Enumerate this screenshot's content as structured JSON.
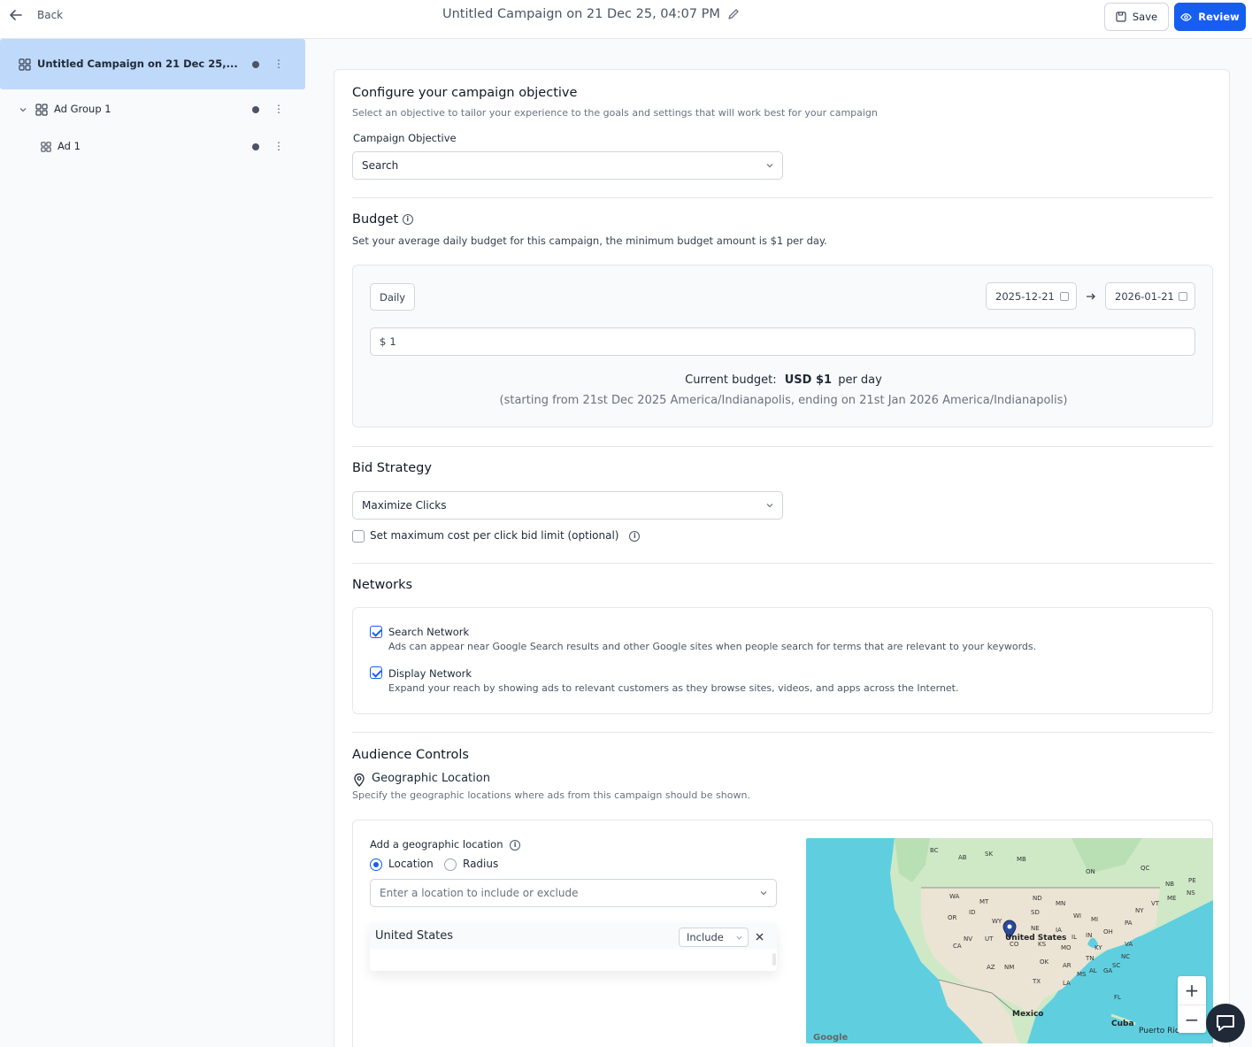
{
  "header": {
    "back_label": "Back",
    "title": "Untitled Campaign on 21 Dec 25, 04:07 PM",
    "save_label": "Save",
    "review_label": "Review"
  },
  "sidebar": {
    "items": [
      {
        "label": "Untitled Campaign on 21 Dec 25,..."
      },
      {
        "label": "Ad Group 1"
      },
      {
        "label": "Ad 1"
      }
    ]
  },
  "objective": {
    "heading": "Configure your campaign objective",
    "description": "Select an objective to tailor your experience to the goals and settings that will work best for your campaign",
    "field_label": "Campaign Objective",
    "value": "Search"
  },
  "budget": {
    "heading": "Budget",
    "description": "Set your average daily budget for this campaign, the minimum budget amount is $1 per day.",
    "type_label": "Daily",
    "start_date": "2025-12-21",
    "end_date": "2026-01-21",
    "amount_prefix": "$",
    "amount": "1",
    "current_prefix": "Current budget:",
    "current_value": "USD $1",
    "current_suffix": "per day",
    "range_text": "(starting from 21st Dec 2025 America/Indianapolis, ending on 21st Jan 2026 America/Indianapolis)"
  },
  "bid": {
    "heading": "Bid Strategy",
    "value": "Maximize Clicks",
    "limit_label": "Set maximum cost per click bid limit (optional)"
  },
  "networks": {
    "heading": "Networks",
    "items": [
      {
        "name": "Search Network",
        "desc": "Ads can appear near Google Search results and other Google sites when people search for terms that are relevant to your keywords."
      },
      {
        "name": "Display Network",
        "desc": "Expand your reach by showing ads to relevant customers as they browse sites, videos, and apps across the Internet."
      }
    ]
  },
  "audience": {
    "heading": "Audience Controls",
    "geo_title": "Geographic Location",
    "geo_desc": "Specify the geographic locations where ads from this campaign should be shown.",
    "add_label": "Add a geographic location",
    "radio_location": "Location",
    "radio_radius": "Radius",
    "placeholder": "Enter a location to include or exclude",
    "selected_location": "United States",
    "include_label": "Include"
  },
  "map": {
    "labels": [
      "United States",
      "Mexico",
      "Cuba",
      "Puerto Rico",
      "WA",
      "OR",
      "NV",
      "UT",
      "AZ",
      "NM",
      "TX",
      "OK",
      "KS",
      "NE",
      "SD",
      "ND",
      "MN",
      "WI",
      "MI",
      "IA",
      "IL",
      "MO",
      "AR",
      "LA",
      "MS",
      "AL",
      "GA",
      "FL",
      "TN",
      "KY",
      "IN",
      "OH",
      "PA",
      "NY",
      "VA",
      "NC",
      "SC",
      "ME",
      "VT",
      "BC",
      "AB",
      "SK",
      "MB",
      "ON",
      "QC",
      "NB",
      "NS",
      "PE",
      "MT",
      "WY",
      "CO",
      "ID",
      "CA"
    ],
    "zoom_in": "+",
    "zoom_out": "−",
    "attribution": "Google"
  }
}
